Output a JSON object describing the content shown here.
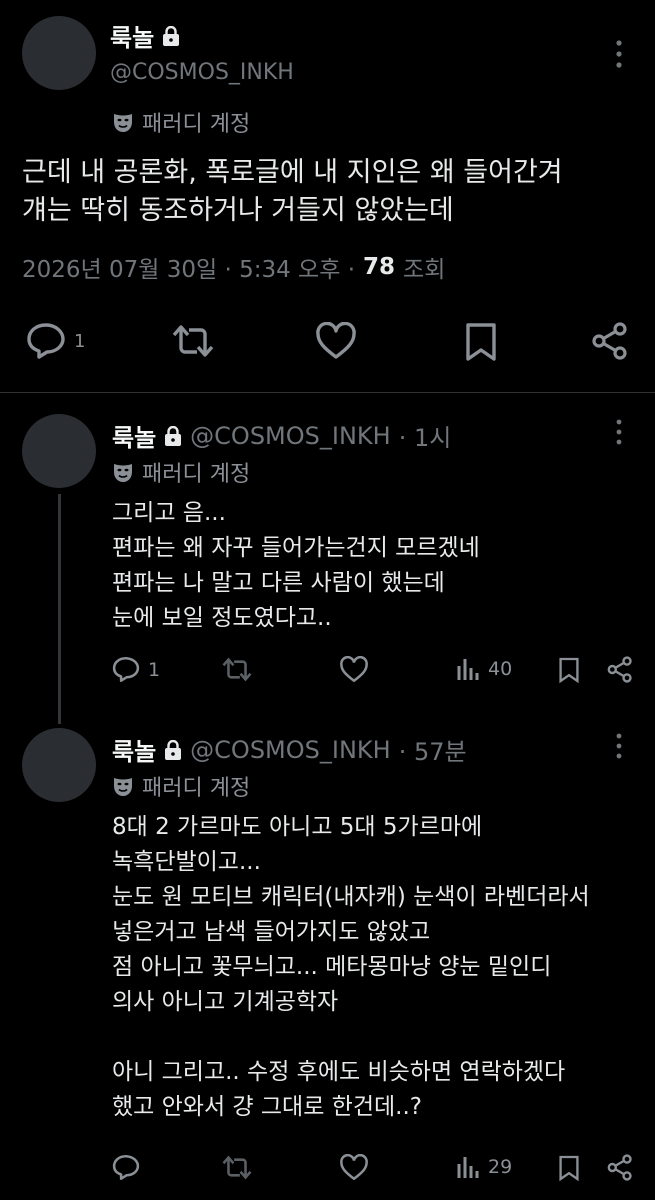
{
  "main_post": {
    "display_name": "룩놀",
    "handle": "@COSMOS_INKH",
    "label": "패러디 계정",
    "text": "근데 내 공론화, 폭로글에 내 지인은 왜 들어간겨\n걔는 딱히 동조하거나 거들지 않았는데",
    "datetime": "2026년 07월 30일 · 5:34 오후 ·",
    "views_count": "78",
    "views_label": "조회",
    "reply_count": "1"
  },
  "replies": [
    {
      "display_name": "룩놀",
      "handle": "@COSMOS_INKH",
      "time": "· 1시",
      "label": "패러디 계정",
      "text": "그리고 음...\n편파는 왜 자꾸 들어가는건지 모르겠네\n편파는 나 말고 다른 사람이 했는데\n눈에 보일 정도였다고..",
      "reply_count": "1",
      "views": "40"
    },
    {
      "display_name": "룩놀",
      "handle": "@COSMOS_INKH",
      "time": "· 57분",
      "label": "패러디 계정",
      "text": "8대 2 가르마도 아니고 5대 5가르마에\n녹흑단발이고...\n눈도 원 모티브 캐릭터(내자캐) 눈색이 라벤더라서\n넣은거고 남색 들어가지도 않았고\n점 아니고 꽃무늬고... 메타몽마냥 양눈 밑인디\n의사 아니고 기계공학자\n\n아니 그리고.. 수정 후에도 비슷하면 연락하겠다\n했고 안와서 걍 그대로 한건데..?",
      "views": "29"
    }
  ]
}
